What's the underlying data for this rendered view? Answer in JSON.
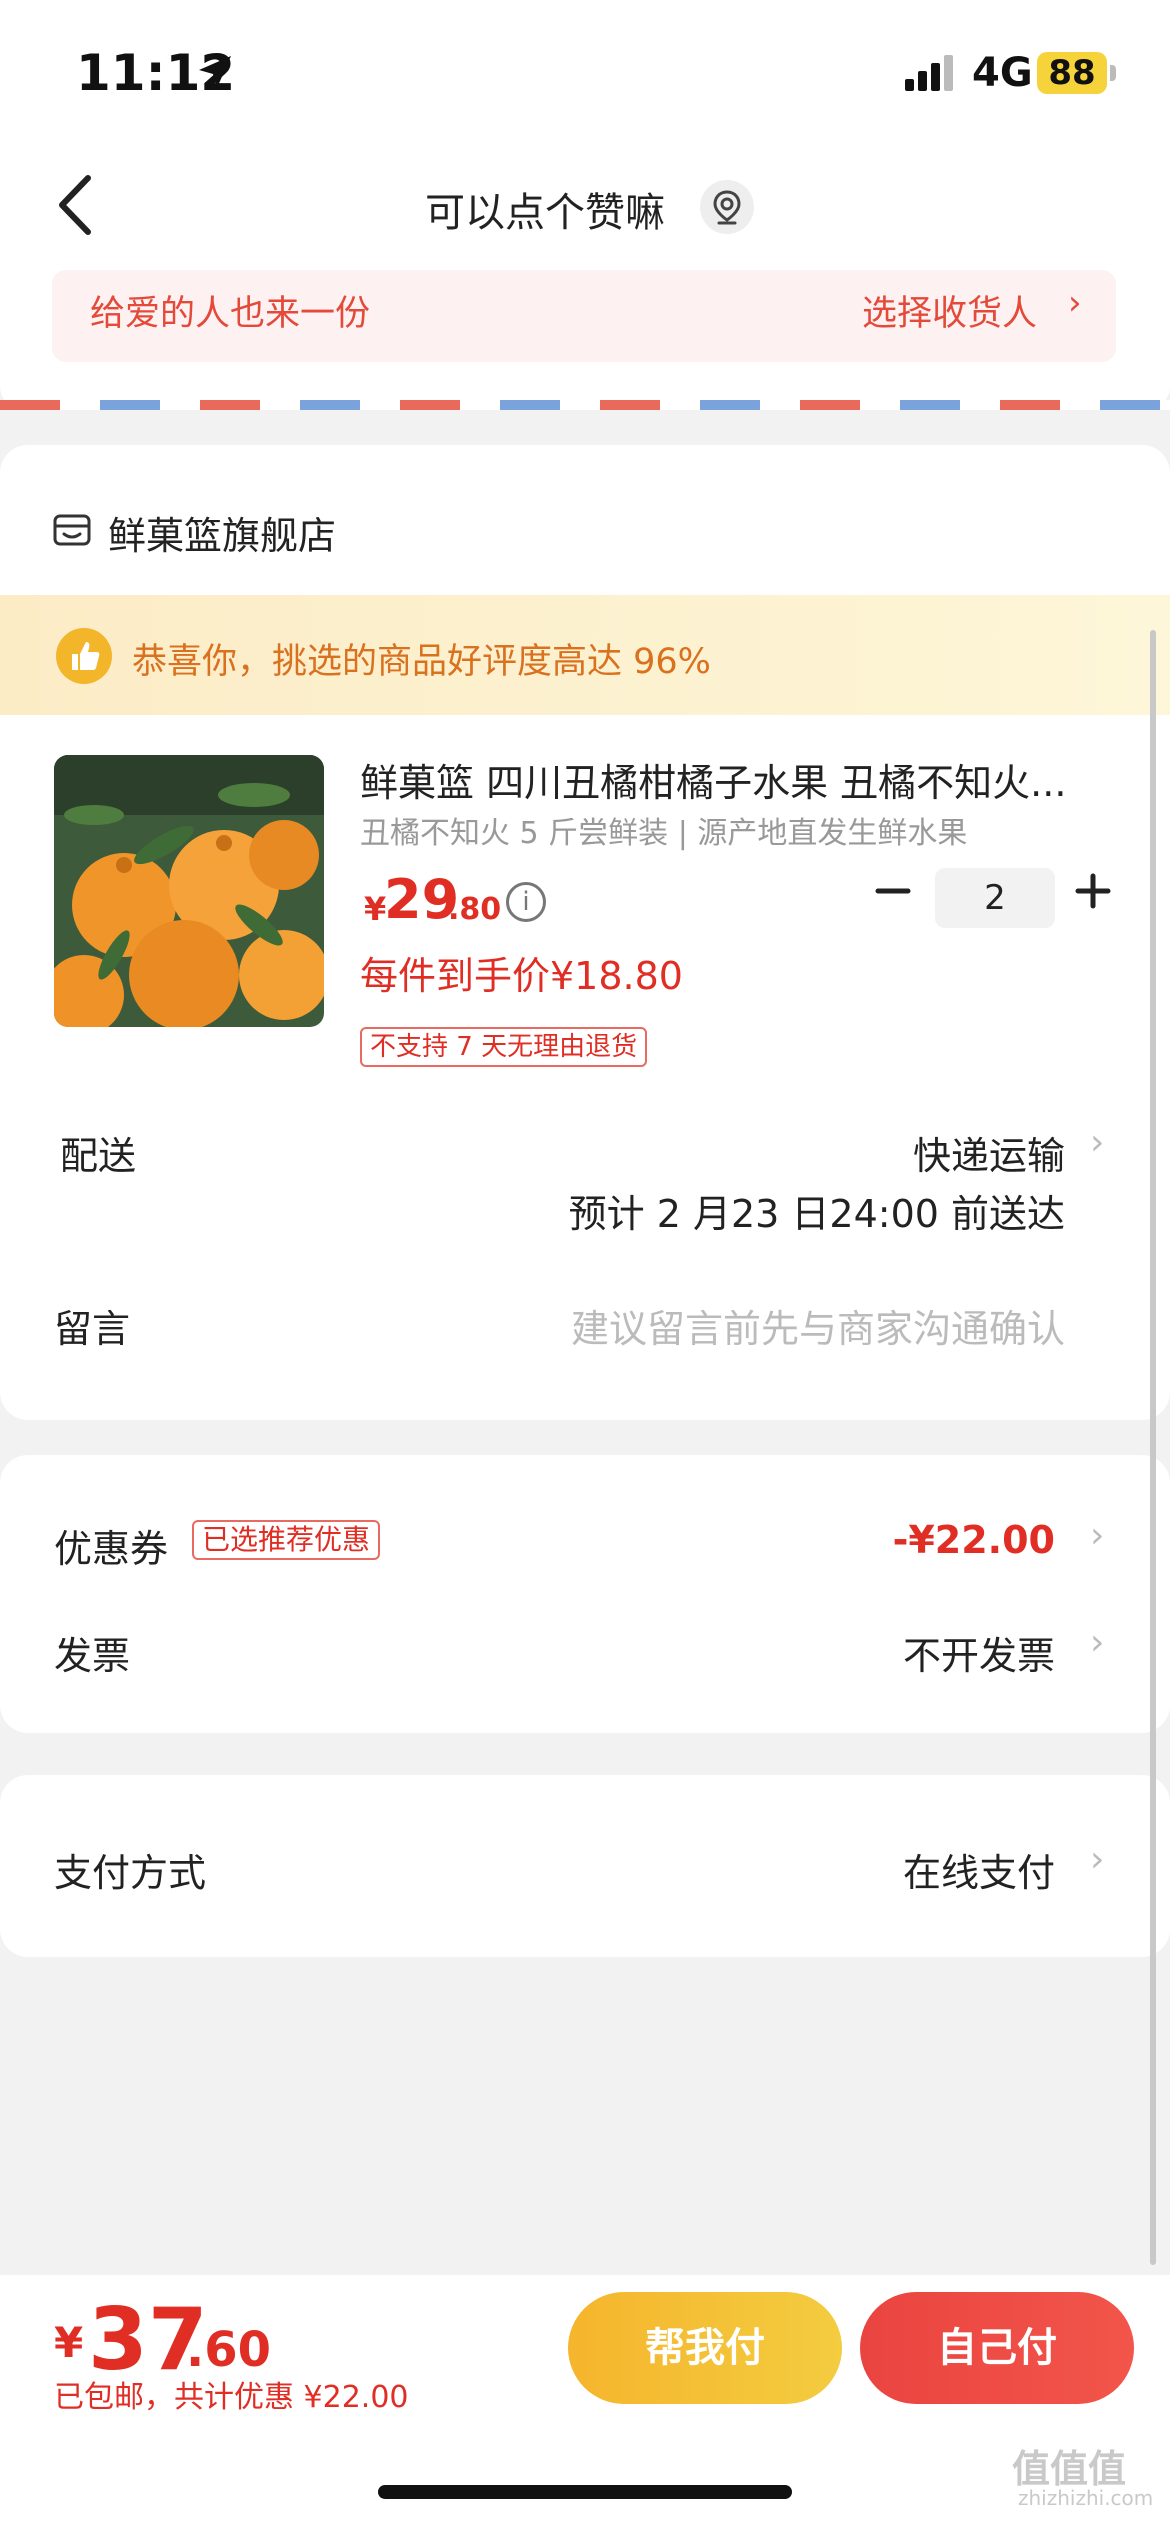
{
  "status_bar": {
    "time": "11:12",
    "network": "4G",
    "battery": "88"
  },
  "nav": {
    "title": "可以点个赞嘛"
  },
  "recipient": {
    "gift_text": "给爱的人也来一份",
    "choose_label": "选择收货人",
    "chevron": "›"
  },
  "shop": {
    "name": "鲜菓篮旗舰店",
    "icon": "shop-icon"
  },
  "praise": {
    "text": "恭喜你，挑选的商品好评度高达 96%"
  },
  "product": {
    "title": "鲜菓篮 四川丑橘柑橘子水果 丑橘不知火...",
    "spec": "丑橘不知火 5 斤尝鲜装 | 源产地直发生鲜水果",
    "price_symbol": "¥",
    "price_int": "29",
    "price_dec": ".80",
    "each_price": "每件到手价¥18.80",
    "tag": "不支持 7 天无理由退货",
    "quantity": "2"
  },
  "delivery": {
    "label": "配送",
    "method": "快递运输",
    "eta": "预计 2 月23 日24:00 前送达"
  },
  "message": {
    "label": "留言",
    "placeholder": "建议留言前先与商家沟通确认"
  },
  "coupon": {
    "label": "优惠券",
    "tag": "已选推荐优惠",
    "value": "-¥22.00"
  },
  "invoice": {
    "label": "发票",
    "value": "不开发票"
  },
  "payment": {
    "label": "支付方式",
    "value": "在线支付"
  },
  "total": {
    "symbol": "¥",
    "int": "37",
    "dec": ".60",
    "note": "已包邮，共计优惠 ¥22.00"
  },
  "buttons": {
    "help_pay": "帮我付",
    "self_pay": "自己付"
  },
  "watermark": {
    "main": "值值值",
    "sub": "zhizhizhi.com"
  },
  "colors": {
    "accent": "#e02e24",
    "gold": "#f5b52d",
    "praise": "#d9711f"
  }
}
